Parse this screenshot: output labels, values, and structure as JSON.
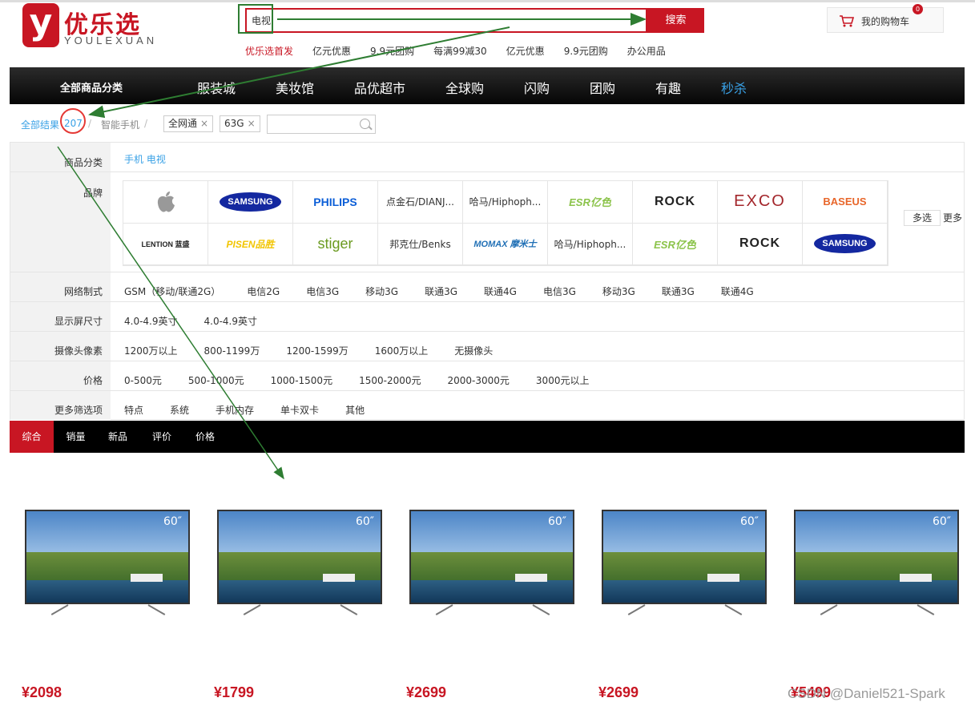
{
  "logo": {
    "mark": "y",
    "cn": "优乐选",
    "en": "YOULEXUAN"
  },
  "search": {
    "value": "电视",
    "button": "搜索"
  },
  "hotwords": [
    "优乐选首发",
    "亿元优惠",
    "9.9元团购",
    "每满99减30",
    "亿元优惠",
    "9.9元团购",
    "办公用品"
  ],
  "cart": {
    "label": "我的购物车",
    "count": "0"
  },
  "nav": {
    "all": "全部商品分类",
    "items": [
      "服装城",
      "美妆馆",
      "品优超市",
      "全球购",
      "闪购",
      "团购",
      "有趣",
      "秒杀"
    ]
  },
  "crumb": {
    "all": "全部结果",
    "count": "207",
    "sep": "/",
    "category": "智能手机",
    "tags": [
      "全网通",
      "63G"
    ],
    "close": "×"
  },
  "filters": {
    "category": {
      "label": "商品分类",
      "options": [
        "手机 电视"
      ]
    },
    "brand": {
      "label": "品牌",
      "items": [
        "",
        "SAMSUNG",
        "PHILIPS",
        "点金石/DIANJ...",
        "哈马/Hiphoph...",
        "ESR亿色",
        "ROCK",
        "EXCO",
        "BASEUS",
        "LENTION 蓝盛",
        "PISEN品胜",
        "stiger",
        "邦克仕/Benks",
        "MOMAX 摩米士",
        "哈马/Hiphoph...",
        "ESR亿色",
        "ROCK",
        "SAMSUNG"
      ],
      "multi": "多选",
      "more": "更多"
    },
    "network": {
      "label": "网络制式",
      "options": [
        "GSM（移动/联通2G）",
        "电信2G",
        "电信3G",
        "移动3G",
        "联通3G",
        "联通4G",
        "电信3G",
        "移动3G",
        "联通3G",
        "联通4G"
      ]
    },
    "screen": {
      "label": "显示屏尺寸",
      "options": [
        "4.0-4.9英寸",
        "4.0-4.9英寸"
      ]
    },
    "camera": {
      "label": "摄像头像素",
      "options": [
        "1200万以上",
        "800-1199万",
        "1200-1599万",
        "1600万以上",
        "无摄像头"
      ]
    },
    "price": {
      "label": "价格",
      "options": [
        "0-500元",
        "500-1000元",
        "1000-1500元",
        "1500-2000元",
        "2000-3000元",
        "3000元以上"
      ]
    },
    "more": {
      "label": "更多筛选项",
      "options": [
        "特点",
        "系统",
        "手机内存",
        "单卡双卡",
        "其他"
      ]
    }
  },
  "sort": [
    "综合",
    "销量",
    "新品",
    "评价",
    "价格"
  ],
  "products": [
    {
      "size": "60″",
      "price": "¥2098"
    },
    {
      "size": "60″",
      "price": "¥1799"
    },
    {
      "size": "60″",
      "price": "¥2699"
    },
    {
      "size": "60″",
      "price": "¥2699"
    },
    {
      "size": "60″",
      "price": "¥5499"
    }
  ],
  "watermark": "CSDN @Daniel521-Spark",
  "colors": {
    "brand_red": "#c81623",
    "annotation_green": "#2e7d32",
    "link_blue": "#39a1e6"
  }
}
